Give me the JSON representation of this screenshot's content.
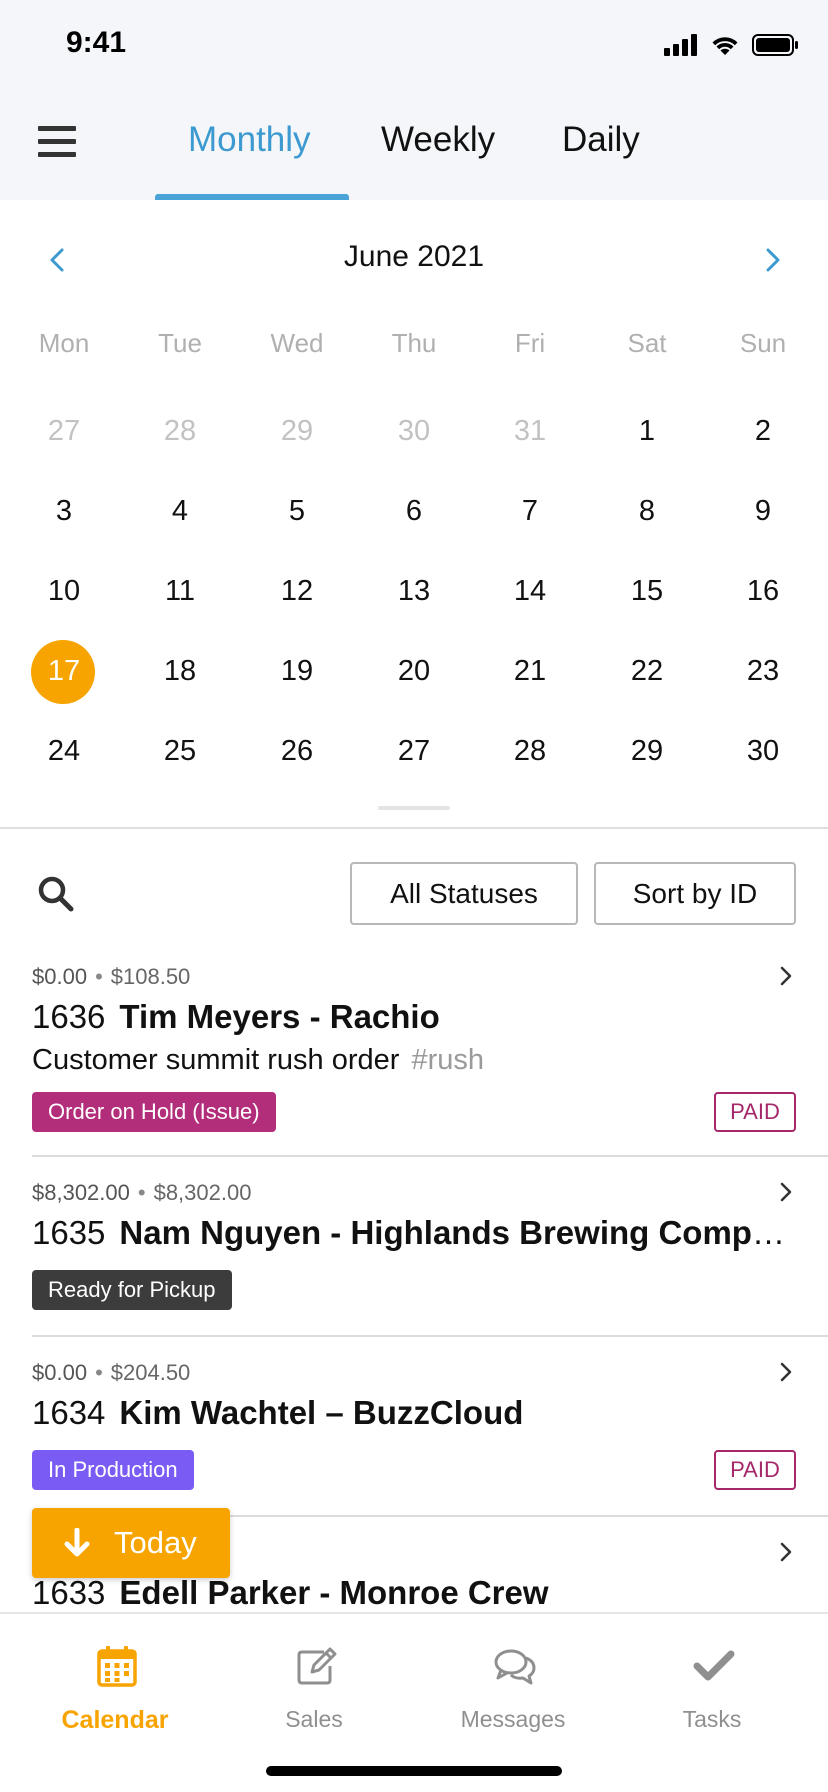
{
  "status_bar": {
    "time": "9:41"
  },
  "nav": {
    "tabs": [
      {
        "label": "Monthly",
        "active": true
      },
      {
        "label": "Weekly",
        "active": false
      },
      {
        "label": "Daily",
        "active": false
      }
    ]
  },
  "calendar": {
    "month_title": "June 2021",
    "weekdays": [
      "Mon",
      "Tue",
      "Wed",
      "Thu",
      "Fri",
      "Sat",
      "Sun"
    ],
    "weeks": [
      [
        {
          "d": "27",
          "muted": true
        },
        {
          "d": "28",
          "muted": true
        },
        {
          "d": "29",
          "muted": true
        },
        {
          "d": "30",
          "muted": true
        },
        {
          "d": "31",
          "muted": true
        },
        {
          "d": "1"
        },
        {
          "d": "2"
        }
      ],
      [
        {
          "d": "3"
        },
        {
          "d": "4"
        },
        {
          "d": "5"
        },
        {
          "d": "6"
        },
        {
          "d": "7"
        },
        {
          "d": "8"
        },
        {
          "d": "9"
        }
      ],
      [
        {
          "d": "10"
        },
        {
          "d": "11"
        },
        {
          "d": "12"
        },
        {
          "d": "13"
        },
        {
          "d": "14"
        },
        {
          "d": "15"
        },
        {
          "d": "16"
        }
      ],
      [
        {
          "d": "17",
          "today": true
        },
        {
          "d": "18"
        },
        {
          "d": "19"
        },
        {
          "d": "20"
        },
        {
          "d": "21"
        },
        {
          "d": "22"
        },
        {
          "d": "23"
        }
      ],
      [
        {
          "d": "24"
        },
        {
          "d": "25"
        },
        {
          "d": "26"
        },
        {
          "d": "27"
        },
        {
          "d": "28"
        },
        {
          "d": "29"
        },
        {
          "d": "30"
        }
      ]
    ],
    "today_color": "#f8a400"
  },
  "filters": {
    "status_label": "All Statuses",
    "sort_label": "Sort by ID"
  },
  "orders": [
    {
      "amount_paid": "$0.00",
      "amount_total": "$108.50",
      "id": "1636",
      "name": "Tim Meyers - Rachio",
      "description": "Customer summit rush order",
      "tag": "#rush",
      "status": "Order on Hold (Issue)",
      "status_color": "#b22d7a",
      "paid": "PAID"
    },
    {
      "amount_paid": "$8,302.00",
      "amount_total": "$8,302.00",
      "id": "1635",
      "name": "Nam Nguyen - Highlands Brewing Company",
      "status": "Ready for Pickup",
      "status_color": "#3c3c3c"
    },
    {
      "amount_paid": "$0.00",
      "amount_total": "$204.50",
      "id": "1634",
      "name": "Kim Wachtel – BuzzCloud",
      "status": "In Production",
      "status_color": "#7a5cf5",
      "paid": "PAID"
    },
    {
      "id": "1633",
      "name": "Edell Parker - Monroe Crew"
    }
  ],
  "today_button": {
    "label": "Today"
  },
  "tabbar": {
    "items": [
      {
        "label": "Calendar",
        "icon": "calendar-icon",
        "active": true
      },
      {
        "label": "Sales",
        "icon": "edit-icon",
        "active": false
      },
      {
        "label": "Messages",
        "icon": "chat-bubbles-icon",
        "active": false
      },
      {
        "label": "Tasks",
        "icon": "checkmark-icon",
        "active": false
      }
    ]
  },
  "colors": {
    "accent_blue": "#3d9ad1",
    "accent_orange": "#f8a400",
    "paid_border": "#a5286a"
  }
}
